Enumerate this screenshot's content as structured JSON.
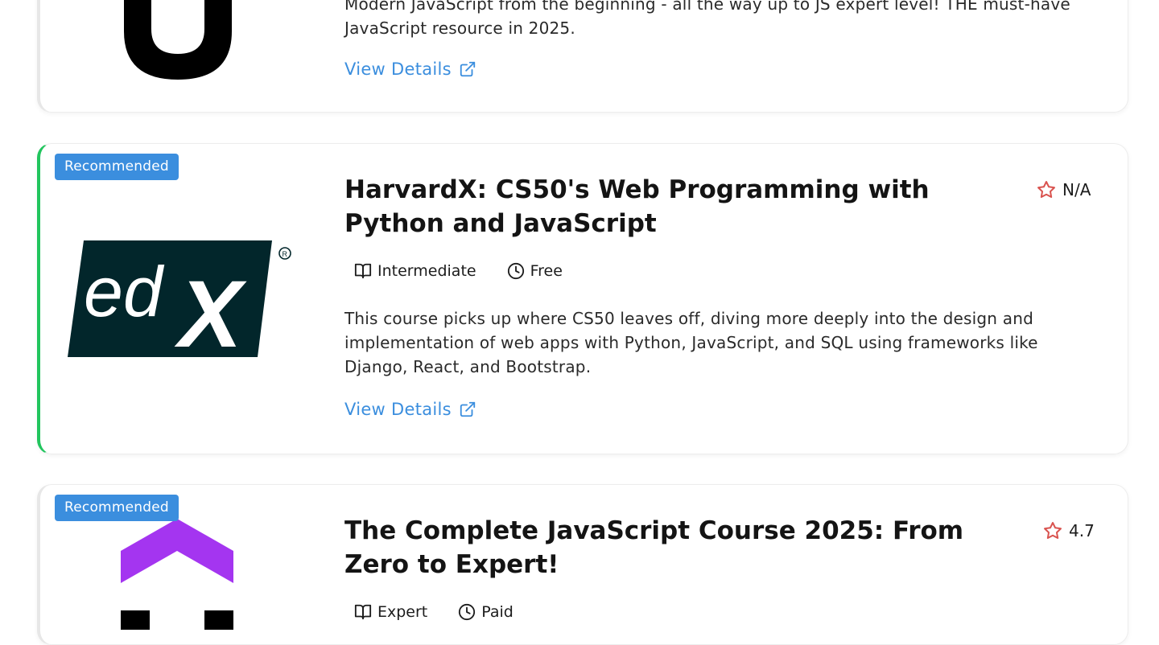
{
  "courses": [
    {
      "description": "Modern JavaScript from the beginning - all the way up to JS expert level! THE must-have JavaScript resource in 2025.",
      "link_label": "View Details",
      "logo": "udemy-logo"
    },
    {
      "badge": "Recommended",
      "logo": "edx-logo",
      "logo_text": "edX",
      "title": "HarvardX: CS50's Web Programming with Python and JavaScript",
      "rating": "N/A",
      "level": "Intermediate",
      "price": "Free",
      "description": "This course picks up where CS50 leaves off, diving more deeply into the design and implementation of web apps with Python, JavaScript, and SQL using frameworks like Django, React, and Bootstrap.",
      "link_label": "View Details"
    },
    {
      "badge": "Recommended",
      "logo": "udemy-logo",
      "title": "The Complete JavaScript Course 2025: From Zero to Expert!",
      "rating": "4.7",
      "level": "Expert",
      "price": "Paid"
    }
  ],
  "colors": {
    "accent_green": "#22c55e",
    "link_blue": "#3b8ede",
    "badge_blue": "#3b8ede",
    "star_red": "#d9534f",
    "edx_dark": "#02262b",
    "udemy_purple": "#a435f0"
  },
  "icons": {
    "rating": "star-outline-icon",
    "level": "book-open-icon",
    "price": "clock-icon",
    "link": "external-link-icon"
  }
}
